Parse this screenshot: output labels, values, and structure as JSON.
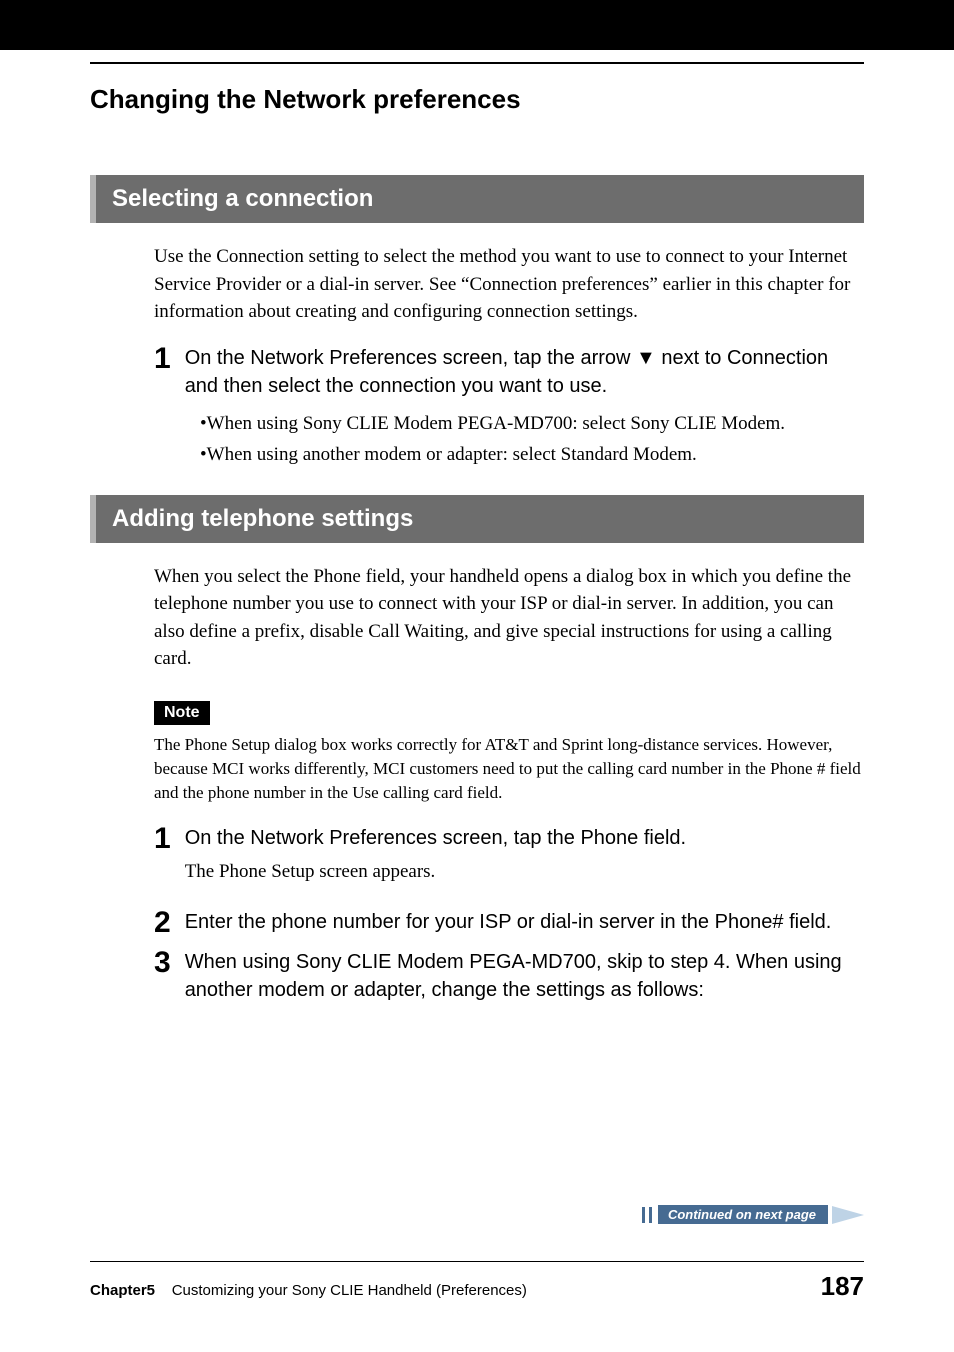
{
  "page": {
    "main_heading": "Changing the Network preferences"
  },
  "section1": {
    "title": "Selecting a connection",
    "intro": "Use the Connection setting to select the method you want to use to connect to your Internet Service Provider or a dial-in server. See “Connection preferences” earlier in this chapter for information about creating and configuring connection settings.",
    "step1_num": "1",
    "step1_text": "On the Network Preferences screen, tap the arrow ▼ next to Connection and then select the connection you want to use.",
    "bullets": [
      "•When using Sony CLIE Modem PEGA-MD700: select Sony CLIE Modem.",
      "•When using another modem or adapter: select Standard Modem."
    ]
  },
  "section2": {
    "title": "Adding telephone settings",
    "intro": "When you select the Phone field, your handheld opens a dialog box in which you define the telephone number you use to connect with your ISP or dial-in server. In addition, you can also define a prefix, disable Call Waiting, and give special instructions for using a calling card.",
    "note_label": "Note",
    "note_text": "The Phone Setup dialog box works correctly for AT&T and Sprint long-distance services. However, because MCI works differently, MCI customers need to put the calling card number in the Phone # field and the phone number in the Use calling card field.",
    "step1_num": "1",
    "step1_text": "On the Network Preferences screen, tap the Phone field.",
    "step1_sub": "The Phone Setup screen appears.",
    "step2_num": "2",
    "step2_text": "Enter the phone number for your ISP or dial-in server in the Phone# field.",
    "step3_num": "3",
    "step3_text": "When using Sony CLIE Modem PEGA-MD700, skip to step 4. When using another modem or adapter, change the settings as follows:"
  },
  "continued": {
    "label": "Continued on next page"
  },
  "footer": {
    "chapter_strong": "Chapter5",
    "chapter_rest": "Customizing your Sony CLIE Handheld (Preferences)",
    "page_number": "187"
  }
}
